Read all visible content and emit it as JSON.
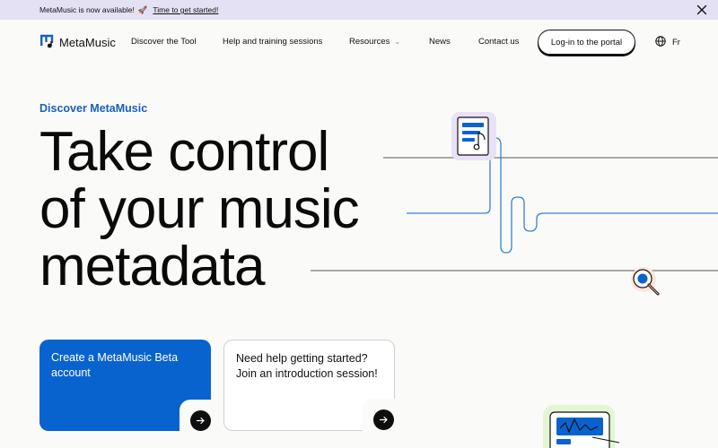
{
  "announcement": {
    "text": "MetaMusic is now available!",
    "emoji": "🚀",
    "link": "Time to get started!"
  },
  "nav": {
    "brand": "MetaMusic",
    "items": [
      {
        "label": "Discover the Tool"
      },
      {
        "label": "Help and training sessions"
      },
      {
        "label": "Resources"
      },
      {
        "label": "News"
      },
      {
        "label": "Contact us"
      }
    ],
    "login": "Log-in to the portal",
    "language": "Fr"
  },
  "hero": {
    "eyebrow": "Discover MetaMusic",
    "title_lines": [
      "Take control",
      "of your music",
      "metadata"
    ]
  },
  "cards": [
    {
      "label": "Create a MetaMusic Beta account"
    },
    {
      "label": "Need help getting started? Join an introduction session!"
    }
  ],
  "colors": {
    "accent": "#0963cf",
    "announce_bg": "#e4e1f5",
    "line_blue": "#3a7fd6"
  },
  "icons": [
    "close-icon",
    "logo-icon",
    "chevron-down-icon",
    "globe-icon",
    "arrow-right-icon",
    "document-music-icon",
    "magnifier-icon",
    "waveform-card-icon"
  ]
}
